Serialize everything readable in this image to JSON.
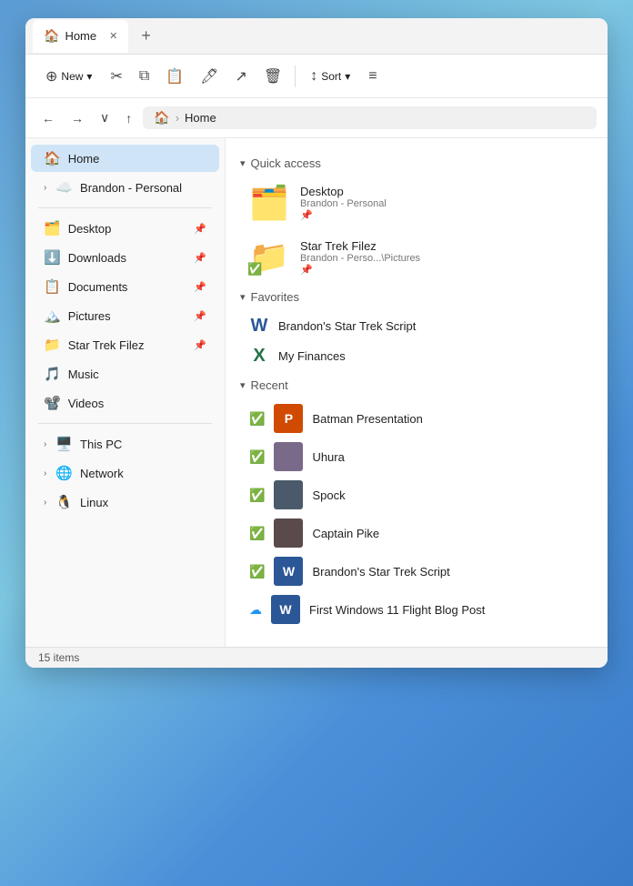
{
  "tab": {
    "title": "Home",
    "home_icon": "🏠",
    "close": "✕",
    "new_tab": "+"
  },
  "toolbar": {
    "new_label": "New",
    "sort_label": "Sort",
    "new_arrow": "▾",
    "sort_arrow": "▾"
  },
  "address": {
    "home_icon": "🏠",
    "separator": "›",
    "path": "Home"
  },
  "sidebar": {
    "home_label": "Home",
    "brandon_label": "Brandon - Personal",
    "items": [
      {
        "label": "Desktop",
        "icon": "🗂️",
        "pinned": true
      },
      {
        "label": "Downloads",
        "icon": "⬇️",
        "pinned": true
      },
      {
        "label": "Documents",
        "icon": "📋",
        "pinned": true
      },
      {
        "label": "Pictures",
        "icon": "🏔️",
        "pinned": true
      },
      {
        "label": "Star Trek Filez",
        "icon": "📁",
        "pinned": true
      },
      {
        "label": "Music",
        "icon": "🎵",
        "pinned": false
      },
      {
        "label": "Videos",
        "icon": "📽️",
        "pinned": false
      }
    ],
    "this_pc_label": "This PC",
    "network_label": "Network",
    "linux_label": "Linux"
  },
  "quick_access": {
    "section_label": "Quick access",
    "items": [
      {
        "name": "Desktop",
        "path": "Brandon - Personal",
        "pin": "📌"
      },
      {
        "name": "Star Trek Filez",
        "path": "Brandon - Perso...\\Pictures",
        "pin": "📌",
        "check": true
      }
    ]
  },
  "favorites": {
    "section_label": "Favorites",
    "items": [
      {
        "name": "Brandon's Star Trek Script",
        "icon_type": "word"
      },
      {
        "name": "My Finances",
        "icon_type": "excel"
      }
    ]
  },
  "recent": {
    "section_label": "Recent",
    "items": [
      {
        "name": "Batman Presentation",
        "icon_type": "ppt",
        "status": "check"
      },
      {
        "name": "Uhura",
        "icon_type": "img",
        "status": "check"
      },
      {
        "name": "Spock",
        "icon_type": "img2",
        "status": "check"
      },
      {
        "name": "Captain Pike",
        "icon_type": "img2",
        "status": "check"
      },
      {
        "name": "Brandon's Star Trek Script",
        "icon_type": "word",
        "status": "check"
      },
      {
        "name": "First Windows 11 Flight Blog Post",
        "icon_type": "word",
        "status": "cloud"
      }
    ]
  },
  "status_bar": {
    "items_count": "15 items"
  }
}
